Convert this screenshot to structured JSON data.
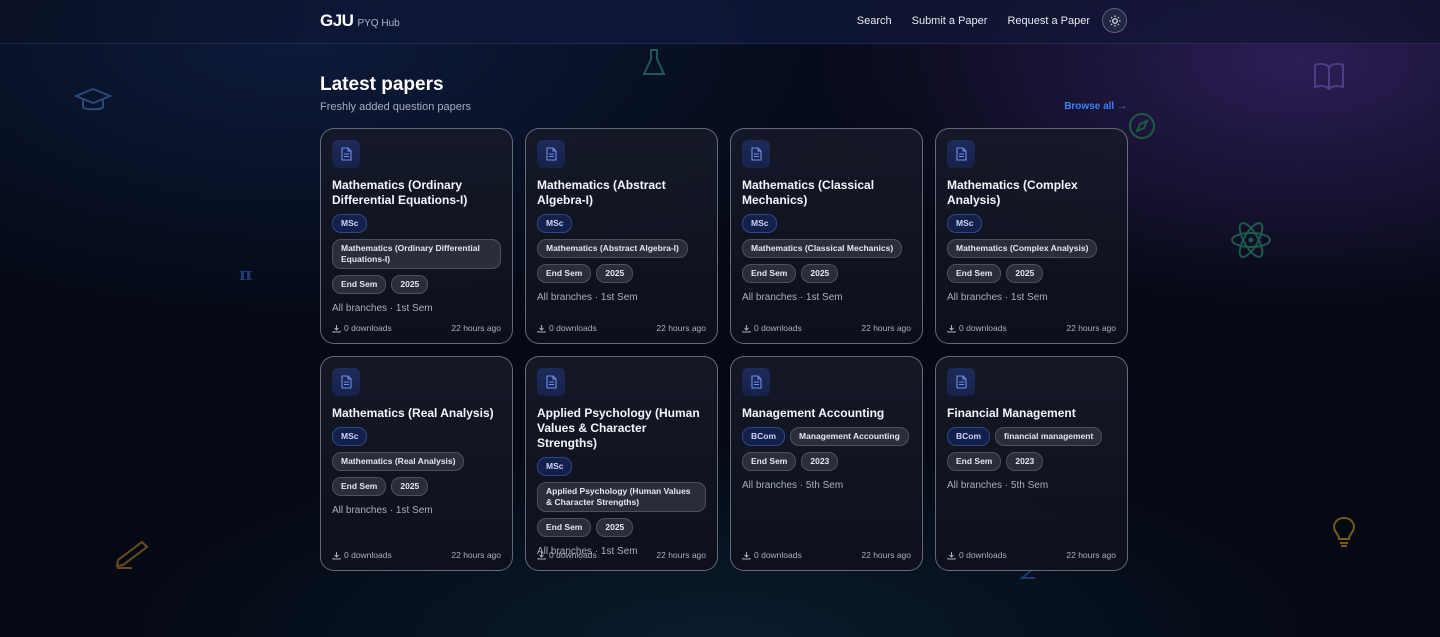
{
  "header": {
    "brand": "GJU",
    "brand_sub": "PYQ Hub",
    "nav": [
      {
        "label": "Search"
      },
      {
        "label": "Submit a Paper"
      },
      {
        "label": "Request a Paper"
      }
    ],
    "theme_icon": "sun-icon"
  },
  "section": {
    "title": "Latest papers",
    "subtitle": "Freshly added question papers",
    "browse_all": "Browse all →"
  },
  "cards": [
    {
      "title": "Mathematics (Ordinary Differential Equations-I)",
      "course": "MSc",
      "subject": "Mathematics (Ordinary Differential Equations-I)",
      "exam": "End Sem",
      "year": "2025",
      "meta": "All branches · 1st Sem",
      "downloads": "0 downloads",
      "time": "22 hours ago"
    },
    {
      "title": "Mathematics (Abstract Algebra-I)",
      "course": "MSc",
      "subject": "Mathematics (Abstract Algebra-I)",
      "exam": "End Sem",
      "year": "2025",
      "meta": "All branches · 1st Sem",
      "downloads": "0 downloads",
      "time": "22 hours ago"
    },
    {
      "title": "Mathematics (Classical Mechanics)",
      "course": "MSc",
      "subject": "Mathematics (Classical Mechanics)",
      "exam": "End Sem",
      "year": "2025",
      "meta": "All branches · 1st Sem",
      "downloads": "0 downloads",
      "time": "22 hours ago"
    },
    {
      "title": "Mathematics (Complex Analysis)",
      "course": "MSc",
      "subject": "Mathematics (Complex Analysis)",
      "exam": "End Sem",
      "year": "2025",
      "meta": "All branches · 1st Sem",
      "downloads": "0 downloads",
      "time": "22 hours ago"
    },
    {
      "title": "Mathematics (Real Analysis)",
      "course": "MSc",
      "subject": "Mathematics (Real Analysis)",
      "exam": "End Sem",
      "year": "2025",
      "meta": "All branches · 1st Sem",
      "downloads": "0 downloads",
      "time": "22 hours ago"
    },
    {
      "title": "Applied Psychology (Human Values & Character Strengths)",
      "course": "MSc",
      "subject": "Applied Psychology (Human Values & Character Strengths)",
      "exam": "End Sem",
      "year": "2025",
      "meta": "All branches · 1st Sem",
      "downloads": "0 downloads",
      "time": "22 hours ago"
    },
    {
      "title": "Management Accounting",
      "course": "BCom",
      "subject": "Management Accounting",
      "exam": "End Sem",
      "year": "2023",
      "meta": "All branches · 5th Sem",
      "downloads": "0 downloads",
      "time": "22 hours ago"
    },
    {
      "title": "Financial Management",
      "course": "BCom",
      "subject": "financial management",
      "exam": "End Sem",
      "year": "2023",
      "meta": "All branches · 5th Sem",
      "downloads": "0 downloads",
      "time": "22 hours ago"
    }
  ],
  "icons": {
    "card_icon": "document-icon",
    "download_icon": "download-icon"
  },
  "colors": {
    "accent": "#3b82f6",
    "background": "#050914",
    "card_bg": "#161a28"
  }
}
